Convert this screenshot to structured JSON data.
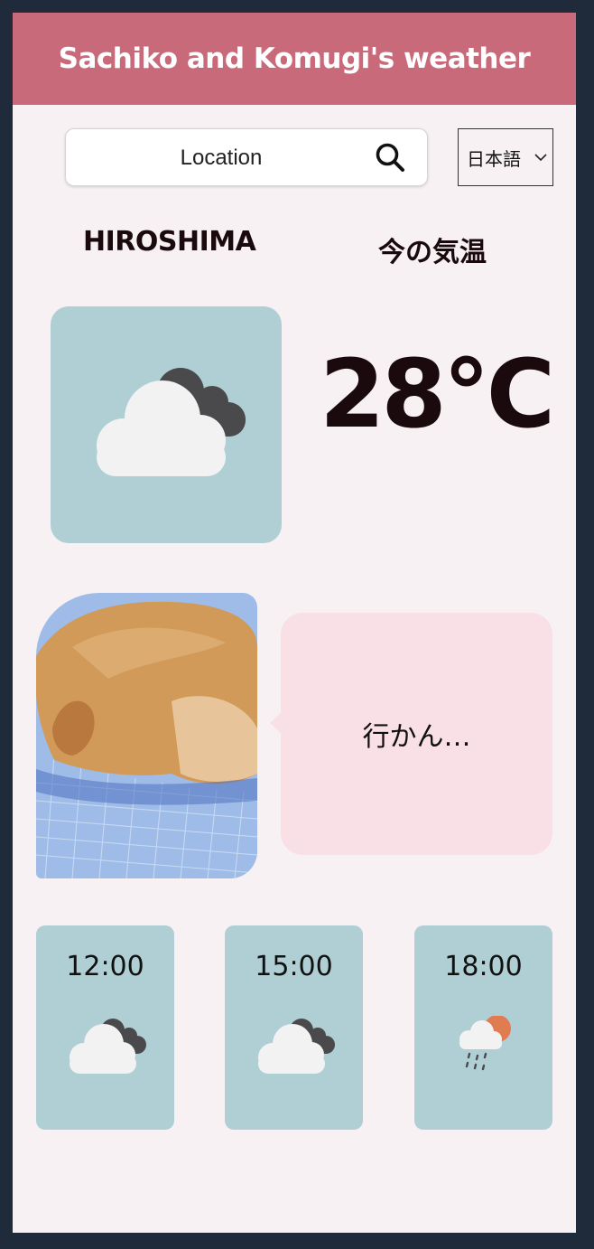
{
  "header": {
    "title": "Sachiko and Komugi's weather"
  },
  "search": {
    "placeholder": "Location"
  },
  "language": {
    "selected": "日本語"
  },
  "current": {
    "city": "HIROSHIMA",
    "label": "今の気温",
    "temperature": "28°C",
    "icon": "cloudy-icon"
  },
  "bubble": {
    "text": "行かん…"
  },
  "hourly": [
    {
      "time": "12:00",
      "icon": "cloudy-icon"
    },
    {
      "time": "15:00",
      "icon": "cloudy-icon"
    },
    {
      "time": "18:00",
      "icon": "rain-sun-icon"
    }
  ],
  "colors": {
    "header": "#c96a7b",
    "background": "#f7f1f4",
    "card": "#b0cfd5",
    "bubble": "#f9dfe6",
    "frame": "#1f2a3a"
  }
}
